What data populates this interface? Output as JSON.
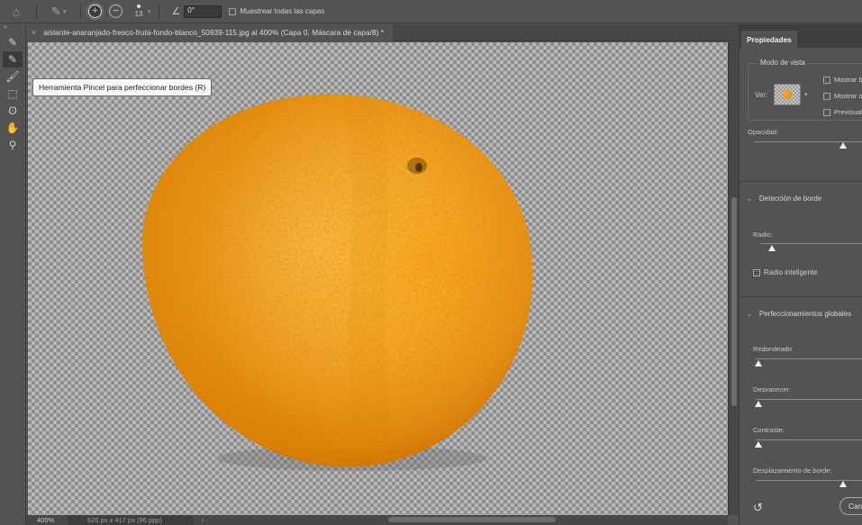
{
  "options_bar": {
    "home_icon": "home-icon",
    "brush_preset_icon": "refine-edge-brush-icon",
    "add_mode": "+",
    "subtract_mode": "−",
    "brush_size": "13",
    "angle_value": "0°",
    "sample_all_layers_label": "Muestrear todas las capas"
  },
  "document": {
    "tab_title": "aislante-anaranjado-fresco-fruta-fondo-blanco_50939-115.jpg al 400% (Capa 0, Máscara de capa/8) *",
    "close": "×"
  },
  "toolbar": {
    "collapse": "»",
    "tools": [
      {
        "name": "quick-selection-tool",
        "glyph": "✎",
        "active": false
      },
      {
        "name": "refine-edge-brush-tool",
        "glyph": "✎",
        "active": true
      },
      {
        "name": "brush-tool",
        "glyph": "🖌",
        "active": false
      },
      {
        "name": "object-selection-tool",
        "glyph": "⬚",
        "active": false
      },
      {
        "name": "lasso-tool",
        "glyph": "ʘ",
        "active": false
      },
      {
        "name": "hand-tool",
        "glyph": "✋",
        "active": false
      },
      {
        "name": "zoom-tool",
        "glyph": "⚲",
        "active": false
      }
    ]
  },
  "tooltip": {
    "text": "Herramienta Pincel para perfeccionar bordes (R)"
  },
  "status_bar": {
    "zoom": "400%",
    "dimensions": "626 px x 417 px (96 ppp)",
    "arrow": "›"
  },
  "properties_panel": {
    "tab": "Propiedades",
    "view_mode": {
      "legend": "Modo de vista",
      "view_label": "Ver:",
      "options": [
        "Mostrar b",
        "Mostrar o",
        "Previsuali"
      ]
    },
    "opacity": {
      "label": "Opacidad:",
      "value_percent": 50
    },
    "edge_detection": {
      "heading": "Detección de borde",
      "radius_label": "Radio:",
      "radius_value_percent": 10,
      "smart_radius_label": "Radio inteligente"
    },
    "global_refinements": {
      "heading": "Perfeccionamientos globales",
      "smooth_label": "Redondeado:",
      "feather_label": "Desvanecer:",
      "contrast_label": "Contraste:",
      "shift_edge_label": "Desplazamiento de borde:"
    },
    "cancel_label": "Cancelar"
  },
  "colors": {
    "orange_light": "#ffb02e",
    "orange_mid": "#f59a0f",
    "orange_dark": "#d86f00"
  }
}
